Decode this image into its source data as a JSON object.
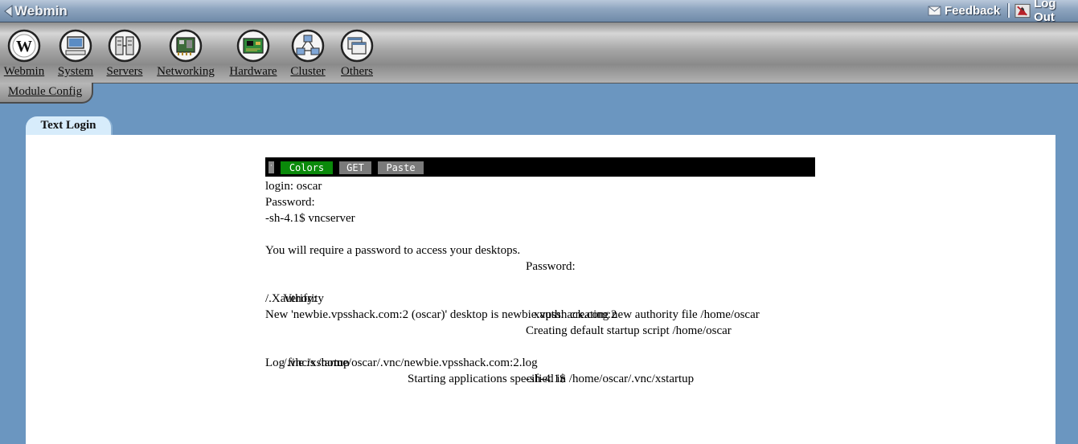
{
  "topbar": {
    "brand": "Webmin",
    "feedback_label": "Feedback",
    "logout_label": "Log Out"
  },
  "categories": [
    {
      "label": "Webmin",
      "icon": "webmin-icon"
    },
    {
      "label": "System",
      "icon": "computer-icon"
    },
    {
      "label": "Servers",
      "icon": "servers-icon"
    },
    {
      "label": "Networking",
      "icon": "network-card-icon"
    },
    {
      "label": "Hardware",
      "icon": "circuit-board-icon"
    },
    {
      "label": "Cluster",
      "icon": "cluster-icon"
    },
    {
      "label": "Others",
      "icon": "windows-icon"
    }
  ],
  "module_config_label": "Module Config",
  "tab_label": "Text Login",
  "terminal": {
    "handle": "·",
    "buttons": {
      "colors": "Colors",
      "get": "GET",
      "paste": "Paste"
    },
    "lines": {
      "l1": "login: oscar",
      "l2": "Password:",
      "l3": "-sh-4.1$ vncserver",
      "l4": "You will require a password to access your desktops.",
      "l5": "Password:",
      "l6a": "Verify:",
      "l6b": "xauth:  creating new authority file /home/oscar",
      "l7": "/.Xauthority",
      "l8": "New 'newbie.vpsshack.com:2 (oscar)' desktop is newbie.vpsshack.com:2",
      "l9": "Creating default startup script /home/oscar",
      "l10a": "/.vnc/xstartup",
      "l10b": "Starting applications specified in /home/oscar/.vnc/xstartup",
      "l11": "Log file is /home/oscar/.vnc/newbie.vpsshack.com:2.log",
      "l12": "-sh-4.1$"
    }
  },
  "colors": {
    "page_background": "#6b96c0",
    "tab_background": "#d7ecfb",
    "colors_button": "#0a8a0a",
    "gray_button": "#7a7a7a"
  }
}
